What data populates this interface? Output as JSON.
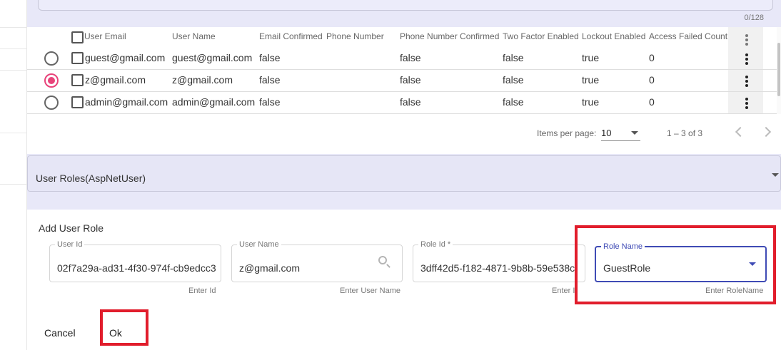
{
  "header": {
    "char_counter": "0/128"
  },
  "table": {
    "columns": [
      "User Email",
      "User Name",
      "Email Confirmed",
      "Phone Number",
      "Phone Number Confirmed",
      "Two Factor Enabled",
      "Lockout Enabled",
      "Access Failed Count"
    ],
    "rows": [
      {
        "email": "guest@gmail.com",
        "username": "guest@gmail.com",
        "email_confirmed": "false",
        "phone": "",
        "phone_confirmed": "false",
        "two_factor": "false",
        "lockout": "true",
        "access_failed": "0",
        "selected": false
      },
      {
        "email": "z@gmail.com",
        "username": "z@gmail.com",
        "email_confirmed": "false",
        "phone": "",
        "phone_confirmed": "false",
        "two_factor": "false",
        "lockout": "true",
        "access_failed": "0",
        "selected": true
      },
      {
        "email": "admin@gmail.com",
        "username": "admin@gmail.com",
        "email_confirmed": "false",
        "phone": "",
        "phone_confirmed": "false",
        "two_factor": "false",
        "lockout": "true",
        "access_failed": "0",
        "selected": false
      }
    ]
  },
  "paginator": {
    "items_per_page_label": "Items per page:",
    "page_size": "10",
    "range": "1 – 3 of 3"
  },
  "roles_panel": {
    "title": "User Roles(AspNetUser)"
  },
  "form": {
    "title": "Add User Role",
    "user_id": {
      "label": "User Id",
      "value": "02f7a29a-ad31-4f30-974f-cb9edcc3",
      "hint": "Enter Id"
    },
    "user_name": {
      "label": "User Name",
      "value": "z@gmail.com",
      "hint": "Enter User Name"
    },
    "role_id": {
      "label": "Role Id *",
      "value": "3dff42d5-f182-4871-9b8b-59e538c",
      "hint": "Enter Id"
    },
    "role_name": {
      "label": "Role Name",
      "value": "GuestRole",
      "hint": "Enter RoleName"
    },
    "cancel_label": "Cancel",
    "ok_label": "Ok"
  },
  "colors": {
    "accent": "#3f4bb5",
    "radio_selected": "#e8437a",
    "highlight_box": "#e11d2c",
    "band": "#e8e8f8"
  }
}
